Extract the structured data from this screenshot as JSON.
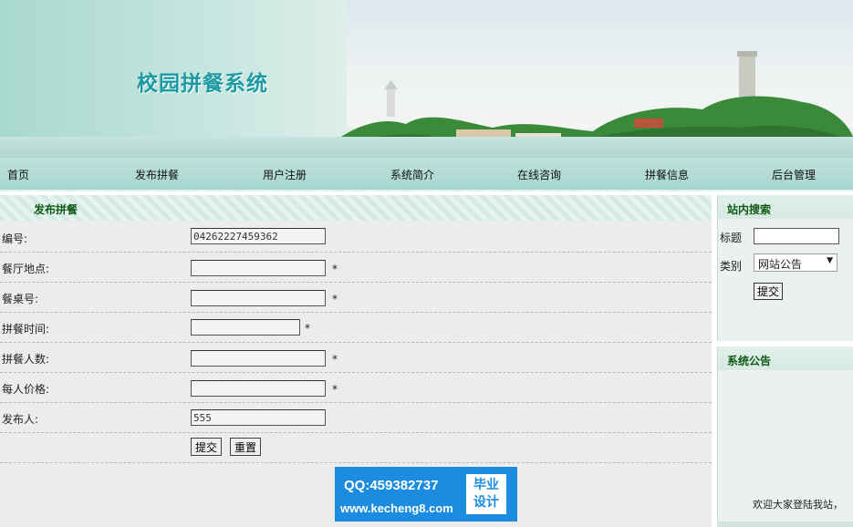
{
  "banner": {
    "title": "校园拼餐系统"
  },
  "nav": {
    "items": [
      "首页",
      "发布拼餐",
      "用户注册",
      "系统简介",
      "在线咨询",
      "拼餐信息",
      "后台管理"
    ]
  },
  "form": {
    "title": "发布拼餐",
    "fields": [
      {
        "label": "编号:",
        "value": "04262227459362",
        "required": false
      },
      {
        "label": "餐厅地点:",
        "value": "",
        "required": true,
        "marker": "*"
      },
      {
        "label": "餐桌号:",
        "value": "",
        "required": true,
        "marker": "*"
      },
      {
        "label": "拼餐时间:",
        "value": "",
        "required": true,
        "marker": "*"
      },
      {
        "label": "拼餐人数:",
        "value": "",
        "required": true,
        "marker": "*"
      },
      {
        "label": "每人价格:",
        "value": "",
        "required": true,
        "marker": "*"
      },
      {
        "label": "发布人:",
        "value": "555",
        "required": false
      }
    ],
    "submit_label": "提交",
    "reset_label": "重置"
  },
  "search": {
    "title": "站内搜索",
    "title_label": "标题",
    "category_label": "类别",
    "category_selected": "网站公告",
    "submit_label": "提交"
  },
  "notice": {
    "title": "系统公告",
    "scroll_text": "欢迎大家登陆我站，"
  },
  "watermark": {
    "qq": "QQ:459382737",
    "site": "www.kecheng8.com",
    "badge_line1": "毕业",
    "badge_line2": "设计"
  },
  "colors": {
    "banner_title": "#1c9aa3",
    "nav_bg": "#a7d6cf",
    "panel_title": "#0f5a17",
    "watermark_bg": "#1c8ce0"
  }
}
